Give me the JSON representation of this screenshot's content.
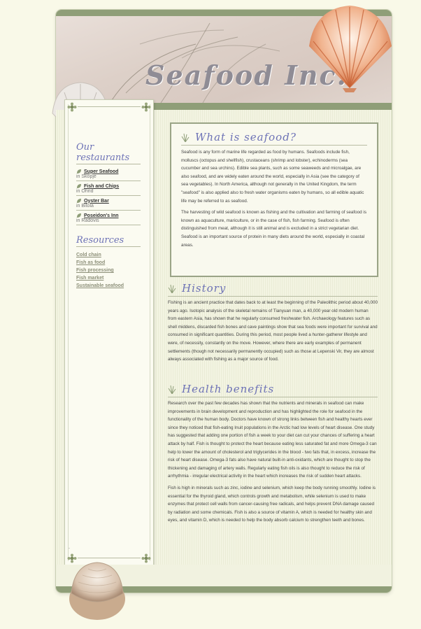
{
  "site": {
    "logo": "Seafood Inc."
  },
  "sidebar": {
    "restaurants_title": "Our restaurants",
    "restaurants": [
      {
        "name": "Super Seafood",
        "city": "in Skopje"
      },
      {
        "name": "Fish and Chips",
        "city": "in Ohrid"
      },
      {
        "name": "Oyster Bar",
        "city": "in Bitola"
      },
      {
        "name": "Poseidon's Inn",
        "city": "in Radovis"
      }
    ],
    "resources_title": "Resources",
    "resources": [
      "Cold chain",
      "Fish as food",
      "Fish processing",
      "Fish market",
      "Sustainable seafood"
    ],
    "bottom_dot": "."
  },
  "sections": {
    "what": {
      "title": "What is seafood?",
      "p1": "Seafood is any form of marine life regarded as food by humans. Seafoods include fish, molluscs (octopus and shellfish), crustaceans (shrimp and lobster), echinoderms (sea cucumber and sea urchins). Edible sea plants, such as some seaweeds and microalgae, are also seafood, and are widely eaten around the world, especially in Asia (see the category of sea vegetables). In North America, although not generally in the United Kingdom, the term \"seafood\" is also applied also to fresh water organisms eaten by humans, so all edible aquatic life may be referred to as seafood.",
      "p2": "The harvesting of wild seafood is known as fishing and the cultivation and farming of seafood is known as aquaculture, mariculture, or in the case of fish, fish farming. Seafood is often distinguished from meat, although it is still animal and is excluded in a strict vegetarian diet. Seafood is an important source of protein in many diets around the world, especially in coastal areas."
    },
    "history": {
      "title": "History",
      "p1": "Fishing is an ancient practice that dates back to at least the beginning of the Paleolithic period about 40,000 years ago. Isotopic analysis of the skeletal remains of Tianyuan man, a 40,000 year old modern human from eastern Asia, has shown that he regularly consumed freshwater fish. Archaeology features such as shell middens, discarded fish bones and cave paintings show that sea foods were important for survival and consumed in significant quantities. During this period, most people lived a hunter-gatherer lifestyle and were, of necessity, constantly on the move. However, where there are early examples of permanent settlements (though not necessarily permanently occupied) such as those at Lepenski Vir, they are almost always associated with fishing as a major source of food."
    },
    "health": {
      "title": "Health benefits",
      "p1": "Research over the past few decades has shown that the nutrients and minerals in seafood can make improvements in brain development and reproduction and has highlighted the role for seafood in the functionality of the human body. Doctors have known of strong links between fish and healthy hearts ever since they noticed that fish-eating Inuit populations in the Arctic had low levels of heart disease. One study has suggested that adding one portion of fish a week to your diet can cut your chances of suffering a heart attack by half. Fish is thought to protect the heart because eating less saturated fat and more Omega-3 can help to lower the amount of cholesterol and triglycerides in the blood - two fats that, in excess, increase the risk of heart disease. Omega-3 fats also have natural built-in anti-oxidants, which are thought to stop the thickening and damaging of artery walls. Regularly eating fish oils is also thought to reduce the risk of arrhythmia - irregular electrical activity in the heart which increases the risk of sudden heart attacks.",
      "p2": "Fish is high in minerals such as zinc, iodine and selenium, which keep the body running smoothly. Iodine is essential for the thyroid gland, which controls growth and metabolism, while selenium is used to make enzymes that protect cell walls from cancer-causing free radicals, and helps prevent DNA damage caused by radiation and some chemicals. Fish is also a source of vitamin A, which is needed for healthy skin and eyes, and vitamin D, which is needed to help the body absorb calcium to strengthen teeth and bones."
    }
  },
  "colors": {
    "accent": "#6d72b6",
    "band": "#8f9e78",
    "background": "#f9f9e8"
  },
  "icons": {
    "heading": "grass-sprig-icon",
    "corner": "flower-ornament-icon",
    "bullet": "leaf-icon"
  }
}
